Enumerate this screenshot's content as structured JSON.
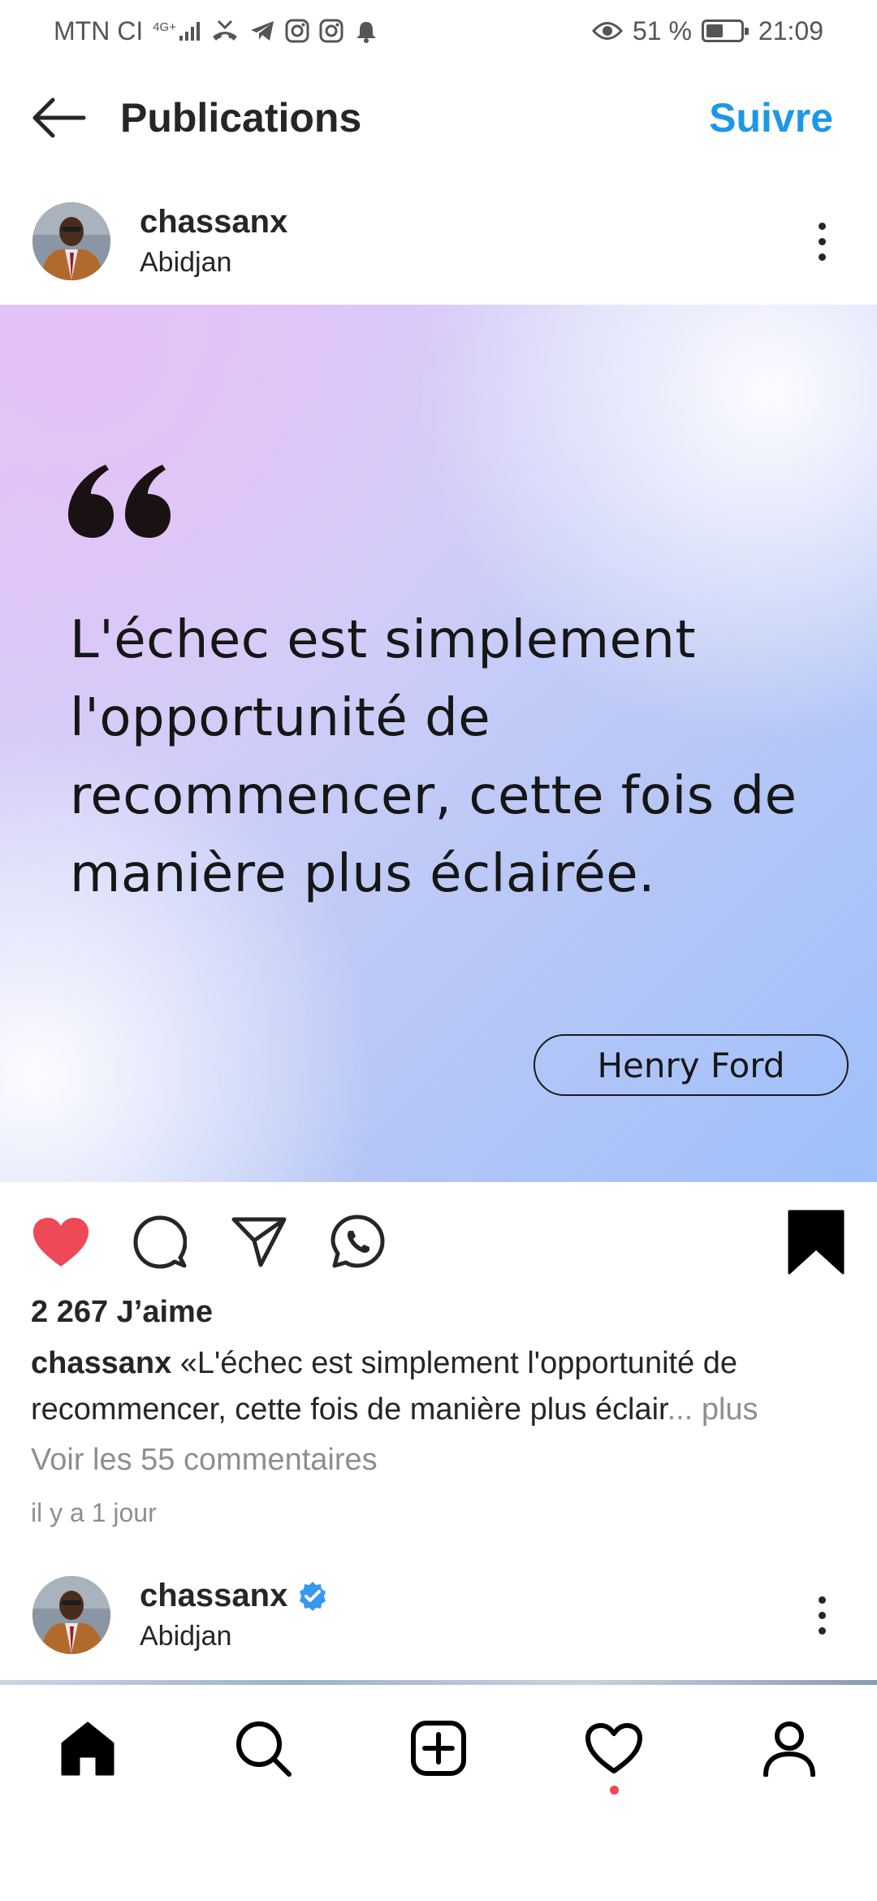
{
  "status_bar": {
    "carrier": "MTN CI",
    "network": "4G+",
    "battery_percent": "51 %",
    "battery_level": 0.51,
    "time": "21:09"
  },
  "app_bar": {
    "title": "Publications",
    "follow_label": "Suivre"
  },
  "post": {
    "username": "chassanx",
    "location": "Abidjan",
    "quote": "L'échec est simplement l'opportunité de recommencer, cette fois de manière plus éclairée.",
    "author": "Henry Ford",
    "likes": "2 267 J’aime",
    "caption_user": "chassanx",
    "caption_text": " «L'échec est simplement l'opportunité de recommencer, cette fois de manière plus éclair",
    "caption_more": "... plus",
    "comments_link": "Voir les 55 commentaires",
    "timestamp": "il y a 1 jour",
    "liked": true,
    "saved": true
  },
  "next_post": {
    "username": "chassanx",
    "location": "Abidjan",
    "verified": true
  },
  "colors": {
    "accent": "#1e98e6",
    "like_red": "#ed4956",
    "text": "#262626",
    "muted": "#8e8e8e",
    "verified_blue": "#3897f0"
  },
  "icons": {
    "back": "arrow-left-icon",
    "more": "more-vertical-icon",
    "like": "heart-filled-icon",
    "comment": "comment-icon",
    "share": "paper-plane-icon",
    "whatsapp": "whatsapp-icon",
    "save": "bookmark-filled-icon",
    "nav": [
      "home-icon",
      "search-icon",
      "add-post-icon",
      "heart-icon",
      "profile-icon"
    ]
  }
}
